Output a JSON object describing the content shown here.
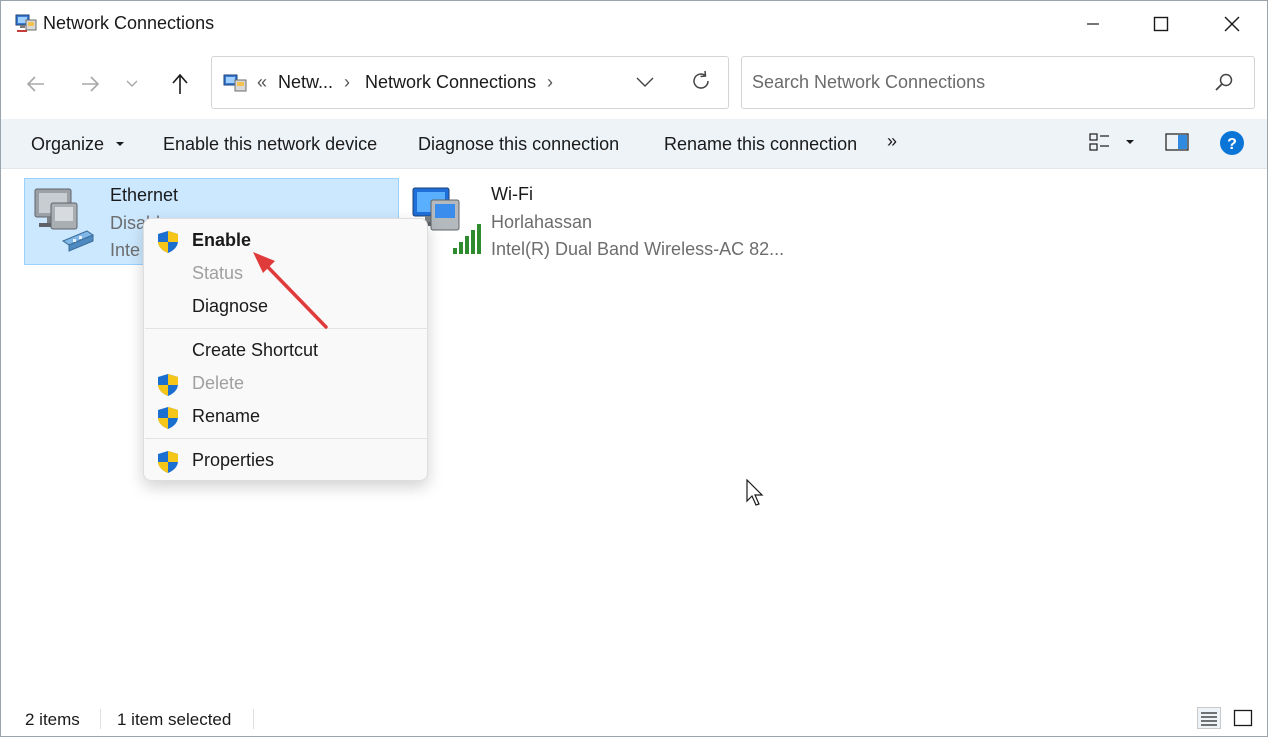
{
  "window": {
    "title": "Network Connections",
    "app_icon": "network-connections-icon"
  },
  "nav": {
    "address": {
      "overflow": "«",
      "crumb_1": "Netw...",
      "separator": "›",
      "crumb_2": "Network Connections",
      "separator_2": "›"
    },
    "search_placeholder": "Search Network Connections"
  },
  "commands": {
    "organize": "Organize",
    "enable_device": "Enable this network device",
    "diagnose": "Diagnose this connection",
    "rename": "Rename this connection",
    "more": "»"
  },
  "items": [
    {
      "name": "Ethernet",
      "status": "Disabled",
      "status_visible": "Disabl",
      "adapter_visible": "Inte",
      "selected": true,
      "icon": "ethernet-adapter-icon"
    },
    {
      "name": "Wi-Fi",
      "status": "Horlahassan",
      "adapter": "Intel(R) Dual Band Wireless-AC 82...",
      "selected": false,
      "icon": "wifi-adapter-icon"
    }
  ],
  "context_menu": {
    "items": [
      {
        "label": "Enable",
        "shield": true,
        "bold": true,
        "disabled": false
      },
      {
        "label": "Status",
        "shield": false,
        "bold": false,
        "disabled": true
      },
      {
        "label": "Diagnose",
        "shield": false,
        "bold": false,
        "disabled": false
      },
      {
        "label": "Create Shortcut",
        "shield": false,
        "bold": false,
        "disabled": false
      },
      {
        "label": "Delete",
        "shield": true,
        "bold": false,
        "disabled": true
      },
      {
        "label": "Rename",
        "shield": true,
        "bold": false,
        "disabled": false
      },
      {
        "label": "Properties",
        "shield": true,
        "bold": false,
        "disabled": false
      }
    ]
  },
  "statusbar": {
    "count": "2 items",
    "selected": "1 item selected"
  },
  "colors": {
    "accent": "#0067c0",
    "selection": "#cce8ff",
    "command_bar": "#eef3f8",
    "annotation_arrow": "#e03b3b"
  }
}
